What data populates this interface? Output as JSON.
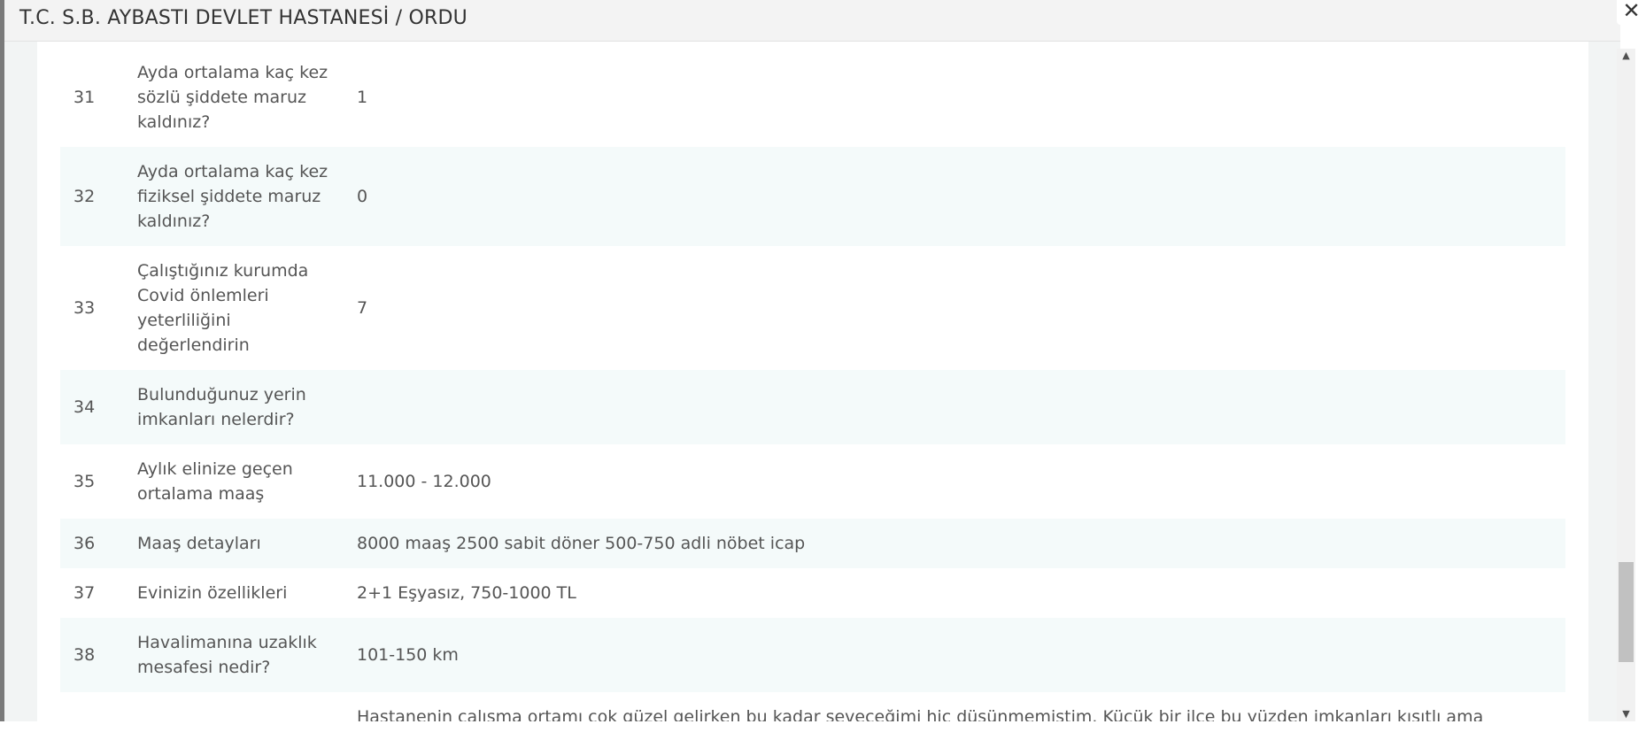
{
  "modal": {
    "title": "T.C. S.B. AYBASTI DEVLET HASTANESİ / ORDU",
    "close_label": "✕"
  },
  "rows": [
    {
      "num": "31",
      "question": "Ayda ortalama kaç kez sözlü şiddete maruz kaldınız?",
      "answer": "1"
    },
    {
      "num": "32",
      "question": "Ayda ortalama kaç kez fiziksel şiddete maruz kaldınız?",
      "answer": "0"
    },
    {
      "num": "33",
      "question": "Çalıştığınız kurumda Covid önlemleri yeterliliğini değerlendirin",
      "answer": "7"
    },
    {
      "num": "34",
      "question": "Bulunduğunuz yerin imkanları nelerdir?",
      "answer": ""
    },
    {
      "num": "35",
      "question": "Aylık elinize geçen ortalama maaş",
      "answer": "11.000 - 12.000"
    },
    {
      "num": "36",
      "question": "Maaş detayları",
      "answer": "8000 maaş 2500 sabit döner 500-750 adli nöbet icap"
    },
    {
      "num": "37",
      "question": "Evinizin özellikleri",
      "answer": "2+1 Eşyasız, 750-1000 TL"
    },
    {
      "num": "38",
      "question": "Havalimanına uzaklık mesafesi nedir?",
      "answer": "101-150 km"
    },
    {
      "num": "",
      "question": "",
      "answer": "Hastanenin çalışma ortamı çok güzel gelirken bu kadar seveceğimi hiç düşünmemiştim. Küçük bir ilçe bu yüzden imkanları kısıtlı ama"
    }
  ],
  "scrollbar": {
    "up_glyph": "▲",
    "down_glyph": "▼"
  }
}
